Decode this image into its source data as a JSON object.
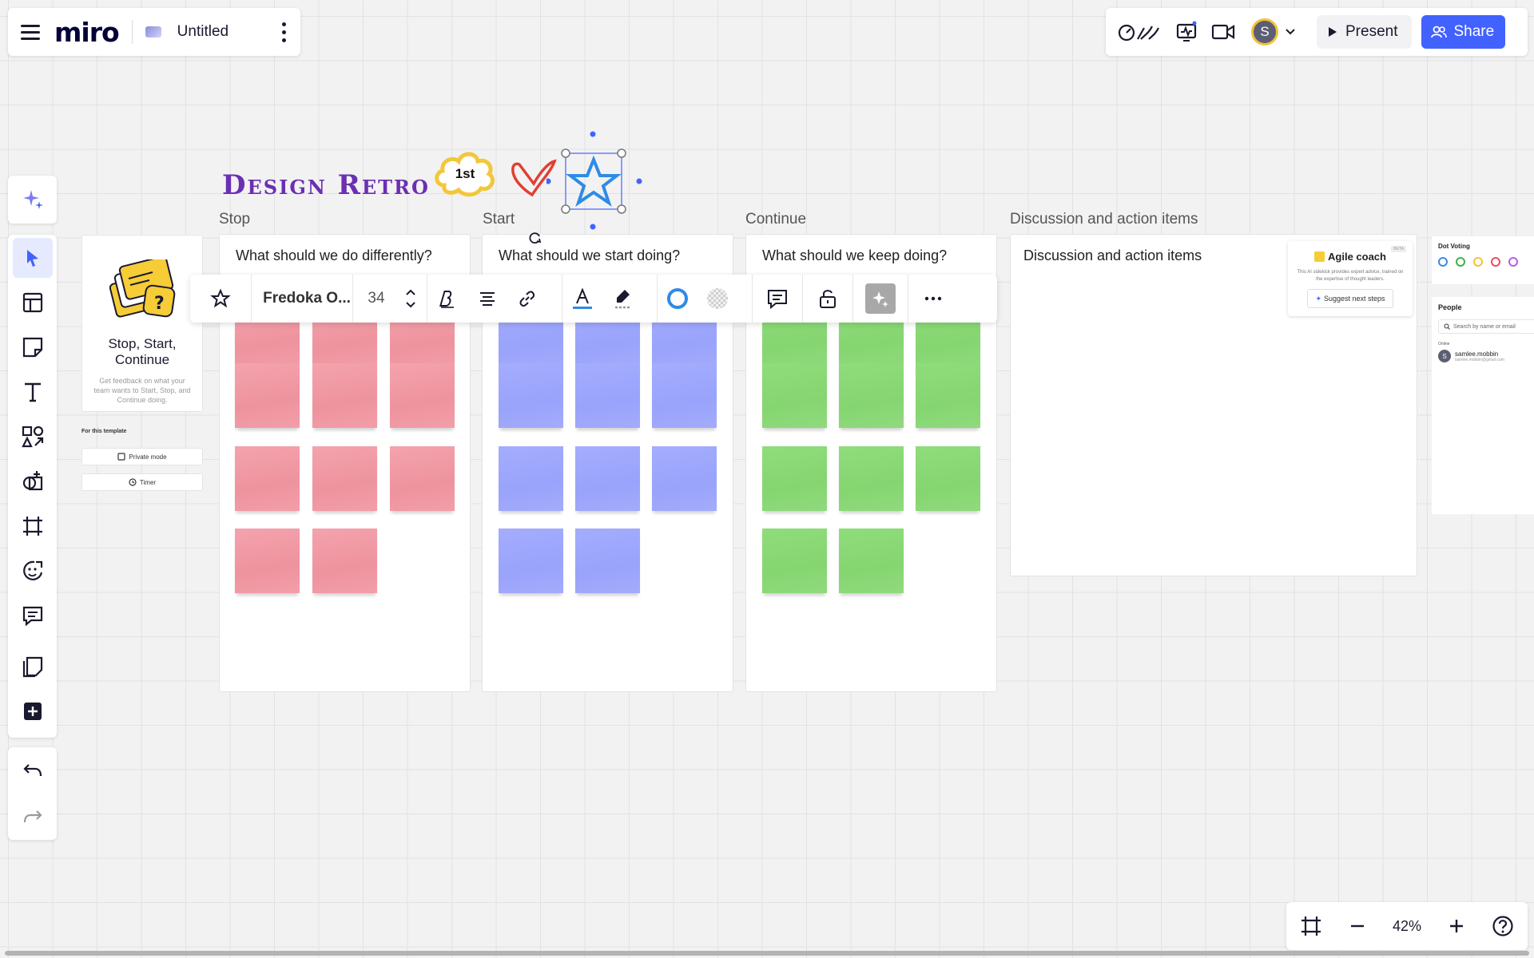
{
  "header": {
    "logo": "miro",
    "board_title": "Untitled",
    "present_label": "Present",
    "share_label": "Share",
    "avatar_initial": "S"
  },
  "board": {
    "title": "Design Retro",
    "sticker_text": "1st",
    "columns": [
      {
        "label": "Stop",
        "prompt": "What should we do differently?",
        "color": "#f29ea9",
        "sticky_count": 11
      },
      {
        "label": "Start",
        "prompt": "What should we start doing?",
        "color": "#a0a8fc",
        "sticky_count": 11
      },
      {
        "label": "Continue",
        "prompt": "What should we keep doing?",
        "color": "#8cd878",
        "sticky_count": 11
      },
      {
        "label": "Discussion and action items",
        "prompt": "Discussion and action items"
      }
    ]
  },
  "template": {
    "title": "Stop, Start, Continue",
    "description": "Get feedback on what your team wants to Start, Stop, and Continue doing.",
    "for_label": "For this template",
    "private_mode": "Private mode",
    "timer": "Timer"
  },
  "format_toolbar": {
    "font": "Fredoka O...",
    "size": "34"
  },
  "agile_coach": {
    "title": "Agile coach",
    "description": "This AI sidekick provides expert advice, trained on the expertise of thought leaders.",
    "button": "Suggest next steps",
    "badge": "BETA"
  },
  "dot_voting": {
    "title": "Dot Voting",
    "colors": [
      "#3a8be8",
      "#3fae4a",
      "#f2c531",
      "#ea4d5a",
      "#b85ee0"
    ]
  },
  "people": {
    "title": "People",
    "search_placeholder": "Search by name or email",
    "online_label": "Online",
    "user_name": "samlee.mobbin",
    "user_email": "samlee.mobbin@gmail.com"
  },
  "zoom": {
    "level": "42%"
  },
  "colors": {
    "accent": "#4262ff",
    "title_purple": "#6a2fb3"
  }
}
